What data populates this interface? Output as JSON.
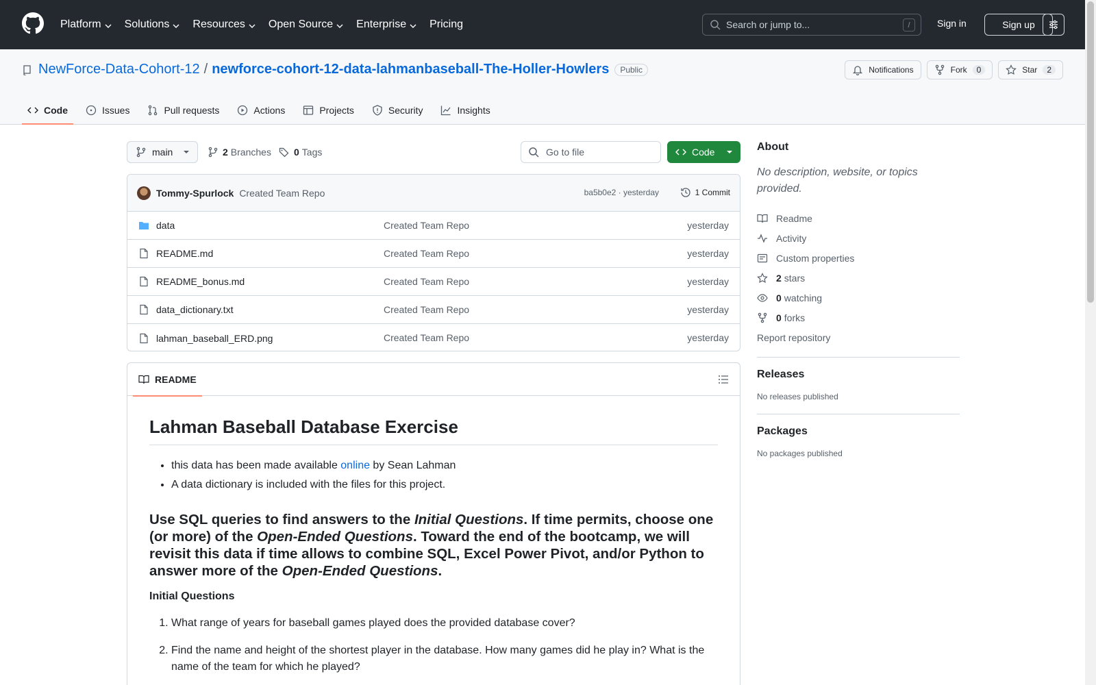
{
  "header": {
    "nav": [
      "Platform",
      "Solutions",
      "Resources",
      "Open Source",
      "Enterprise",
      "Pricing"
    ],
    "search_placeholder": "Search or jump to...",
    "search_shortcut": "/",
    "sign_in": "Sign in",
    "sign_up": "Sign up"
  },
  "repo": {
    "owner": "NewForce-Data-Cohort-12",
    "separator": "/",
    "name": "newforce-cohort-12-data-lahmanbaseball-The-Holler-Howlers",
    "visibility": "Public",
    "notifications_label": "Notifications",
    "fork_label": "Fork",
    "fork_count": "0",
    "star_label": "Star",
    "star_count": "2",
    "tabs": [
      "Code",
      "Issues",
      "Pull requests",
      "Actions",
      "Projects",
      "Security",
      "Insights"
    ]
  },
  "toolbar": {
    "branch": "main",
    "branches_count": "2",
    "branches_label": "Branches",
    "tags_count": "0",
    "tags_label": "Tags",
    "goto_placeholder": "Go to file",
    "code_label": "Code"
  },
  "commit": {
    "author": "Tommy-Spurlock",
    "message": "Created Team Repo",
    "meta": "ba5b0e2 · yesterday",
    "count": "1 Commit"
  },
  "files": [
    {
      "name": "data",
      "type": "folder",
      "message": "Created Team Repo",
      "time": "yesterday"
    },
    {
      "name": "README.md",
      "type": "file",
      "message": "Created Team Repo",
      "time": "yesterday"
    },
    {
      "name": "README_bonus.md",
      "type": "file",
      "message": "Created Team Repo",
      "time": "yesterday"
    },
    {
      "name": "data_dictionary.txt",
      "type": "file",
      "message": "Created Team Repo",
      "time": "yesterday"
    },
    {
      "name": "lahman_baseball_ERD.png",
      "type": "file",
      "message": "Created Team Repo",
      "time": "yesterday"
    }
  ],
  "readme": {
    "tab": "README",
    "title": "Lahman Baseball Database Exercise",
    "bullet1_pre": "this data has been made available ",
    "bullet1_link": "online",
    "bullet1_post": " by Sean Lahman",
    "bullet2": "A data dictionary is included with the files for this project.",
    "h2_a": "Use SQL queries to find answers to the ",
    "h2_b": "Initial Questions",
    "h2_c": ". If time permits, choose one (or more) of the ",
    "h2_d": "Open-Ended Questions",
    "h2_e": ". Toward the end of the bootcamp, we will revisit this data if time allows to combine SQL, Excel Power Pivot, and/or Python to answer more of the ",
    "h2_f": "Open-Ended Questions",
    "h2_g": ".",
    "h3": "Initial Questions",
    "q1": "What range of years for baseball games played does the provided database cover?",
    "q2": "Find the name and height of the shortest player in the database. How many games did he play in? What is the name of the team for which he played?"
  },
  "sidebar": {
    "about_title": "About",
    "about_desc": "No description, website, or topics provided.",
    "readme": "Readme",
    "activity": "Activity",
    "custom_properties": "Custom properties",
    "stars_count": "2",
    "stars_label": "stars",
    "watching_count": "0",
    "watching_label": "watching",
    "forks_count": "0",
    "forks_label": "forks",
    "report": "Report repository",
    "releases_title": "Releases",
    "releases_desc": "No releases published",
    "packages_title": "Packages",
    "packages_desc": "No packages published"
  }
}
